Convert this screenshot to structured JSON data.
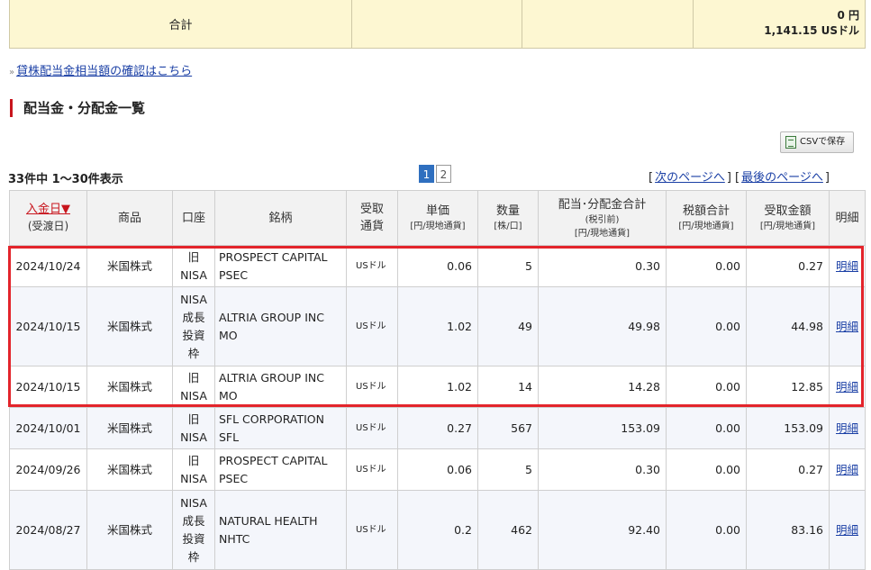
{
  "summary": {
    "label": "合計",
    "amount_jpy": "0 円",
    "amount_usd": "1,141.15 USドル"
  },
  "lending_link": "貸株配当金相当額の確認はこちら",
  "section_title": "配当金・分配金一覧",
  "csv_button": "CSVで保存",
  "count_text": "33件中 1～30件表示",
  "pager": {
    "current": "1",
    "next": "2"
  },
  "nav": {
    "next_page": "次のページへ",
    "last_page": "最後のページへ"
  },
  "headers": {
    "date": "入金日▼",
    "date_sub": "(受渡日)",
    "product": "商品",
    "account": "口座",
    "name": "銘柄",
    "currency": "受取通貨",
    "unit": "単価",
    "unit_sub": "[円/現地通貨]",
    "qty": "数量",
    "qty_sub": "[株/口]",
    "total": "配当･分配金合計",
    "total_sub1": "(税引前)",
    "total_sub2": "[円/現地通貨]",
    "tax": "税額合計",
    "tax_sub": "[円/現地通貨]",
    "received": "受取金額",
    "received_sub": "[円/現地通貨]",
    "detail": "明細"
  },
  "rows": [
    {
      "date": "2024/10/24",
      "product": "米国株式",
      "account": [
        "旧",
        "NISA"
      ],
      "name": [
        "PROSPECT CAPITAL",
        "PSEC"
      ],
      "currency": "USドル",
      "unit": "0.06",
      "qty": "5",
      "total": "0.30",
      "tax": "0.00",
      "received": "0.27",
      "detail": "明細"
    },
    {
      "date": "2024/10/15",
      "product": "米国株式",
      "account": [
        "NISA",
        "成長",
        "投資",
        "枠"
      ],
      "name": [
        "ALTRIA GROUP INC",
        "MO"
      ],
      "currency": "USドル",
      "unit": "1.02",
      "qty": "49",
      "total": "49.98",
      "tax": "0.00",
      "received": "44.98",
      "detail": "明細"
    },
    {
      "date": "2024/10/15",
      "product": "米国株式",
      "account": [
        "旧",
        "NISA"
      ],
      "name": [
        "ALTRIA GROUP INC",
        "MO"
      ],
      "currency": "USドル",
      "unit": "1.02",
      "qty": "14",
      "total": "14.28",
      "tax": "0.00",
      "received": "12.85",
      "detail": "明細"
    },
    {
      "date": "2024/10/01",
      "product": "米国株式",
      "account": [
        "旧",
        "NISA"
      ],
      "name": [
        "SFL CORPORATION",
        "SFL"
      ],
      "currency": "USドル",
      "unit": "0.27",
      "qty": "567",
      "total": "153.09",
      "tax": "0.00",
      "received": "153.09",
      "detail": "明細"
    },
    {
      "date": "2024/09/26",
      "product": "米国株式",
      "account": [
        "旧",
        "NISA"
      ],
      "name": [
        "PROSPECT CAPITAL",
        "PSEC"
      ],
      "currency": "USドル",
      "unit": "0.06",
      "qty": "5",
      "total": "0.30",
      "tax": "0.00",
      "received": "0.27",
      "detail": "明細"
    },
    {
      "date": "2024/08/27",
      "product": "米国株式",
      "account": [
        "NISA",
        "成長",
        "投資",
        "枠"
      ],
      "name": [
        "NATURAL HEALTH",
        "NHTC"
      ],
      "currency": "USドル",
      "unit": "0.2",
      "qty": "462",
      "total": "92.40",
      "tax": "0.00",
      "received": "83.16",
      "detail": "明細"
    }
  ]
}
